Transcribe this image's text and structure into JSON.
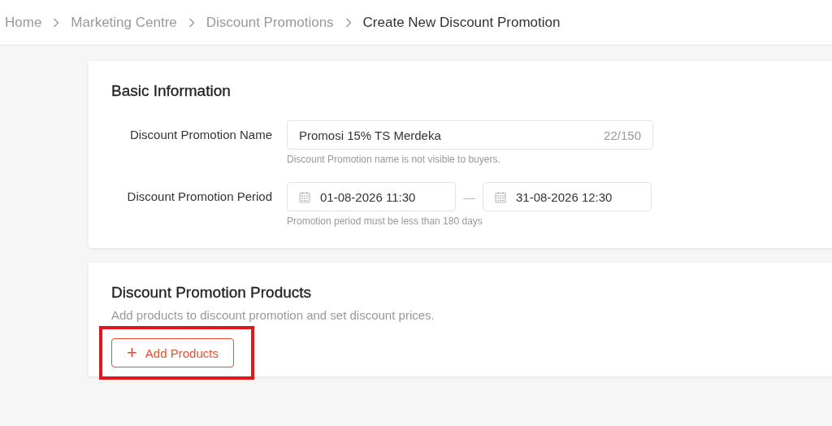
{
  "breadcrumb": [
    {
      "label": "Home",
      "current": false
    },
    {
      "label": "Marketing Centre",
      "current": false
    },
    {
      "label": "Discount Promotions",
      "current": false
    },
    {
      "label": "Create New Discount Promotion",
      "current": true
    }
  ],
  "basic_information": {
    "title": "Basic Information",
    "name_field": {
      "label": "Discount Promotion Name",
      "value": "Promosi 15% TS Merdeka",
      "counter": "22/150",
      "hint": "Discount Promotion name is not visible to buyers."
    },
    "period_field": {
      "label": "Discount Promotion Period",
      "start": "01-08-2026 11:30",
      "separator": "—",
      "end": "31-08-2026 12:30",
      "hint": "Promotion period must be less than 180 days"
    }
  },
  "products": {
    "title": "Discount Promotion Products",
    "description": "Add products to discount promotion and set discount prices.",
    "add_button": {
      "icon": "+",
      "label": "Add Products",
      "highlighted": true
    }
  }
}
